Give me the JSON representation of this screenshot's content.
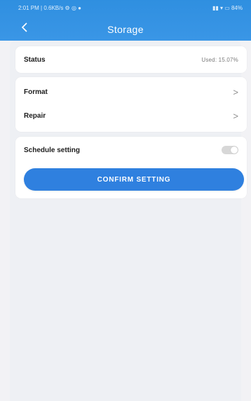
{
  "status_bar": {
    "left": "2:01 PM | 0.6KB/s ⚙ ◎ ●",
    "right": "▮▮ ▾ ▭ 84%"
  },
  "header": {
    "back_icon": "chevron-left",
    "title": "Storage"
  },
  "status_card": {
    "label": "Status",
    "value": "Used: 15.07%"
  },
  "actions": [
    {
      "label": "Format",
      "chevron": ">"
    },
    {
      "label": "Repair",
      "chevron": ">"
    }
  ],
  "schedule": {
    "label": "Schedule setting",
    "enabled": false
  },
  "confirm_label": "CONFIRM SETTING",
  "colors": {
    "header_blue": "#3a96e6",
    "button_blue": "#2f80df",
    "background": "#eef0f4"
  }
}
